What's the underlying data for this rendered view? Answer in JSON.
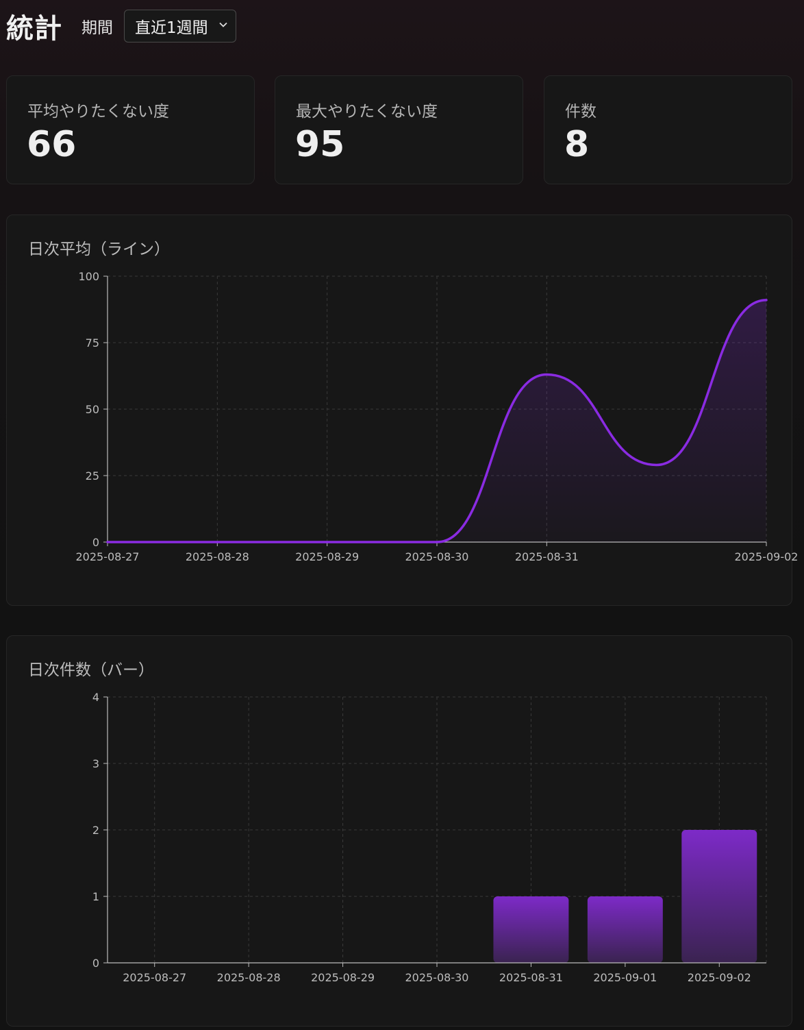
{
  "header": {
    "title": "統計",
    "period_label": "期間",
    "period_selected": "直近1週間"
  },
  "stats": [
    {
      "label": "平均やりたくない度",
      "value": "66"
    },
    {
      "label": "最大やりたくない度",
      "value": "95"
    },
    {
      "label": "件数",
      "value": "8"
    }
  ],
  "colors": {
    "accent": "#8a2be2",
    "bar_top": "#7d2ac8",
    "bar_bottom": "#3a2350",
    "card_bg": "#171717",
    "grid": "#3a3a3a",
    "axis": "#bdbdbd"
  },
  "chart_data": [
    {
      "type": "line",
      "title": "日次平均（ライン）",
      "x": [
        "2025-08-27",
        "2025-08-28",
        "2025-08-29",
        "2025-08-30",
        "2025-08-31",
        "2025-09-01",
        "2025-09-02"
      ],
      "x_tick_labels": [
        "2025-08-27",
        "2025-08-28",
        "2025-08-29",
        "2025-08-30",
        "2025-08-31",
        "2025-09-02"
      ],
      "y": [
        0,
        0,
        0,
        0,
        63,
        29,
        91
      ],
      "ylim": [
        0,
        100
      ],
      "yticks": [
        0,
        25,
        50,
        75,
        100
      ],
      "smooth": true,
      "area_fill": true,
      "grid": true
    },
    {
      "type": "bar",
      "title": "日次件数（バー）",
      "categories": [
        "2025-08-27",
        "2025-08-28",
        "2025-08-29",
        "2025-08-30",
        "2025-08-31",
        "2025-09-01",
        "2025-09-02"
      ],
      "values": [
        0,
        0,
        0,
        0,
        1,
        1,
        2
      ],
      "ylim": [
        0,
        4
      ],
      "yticks": [
        0,
        1,
        2,
        3,
        4
      ],
      "grid": true
    }
  ]
}
